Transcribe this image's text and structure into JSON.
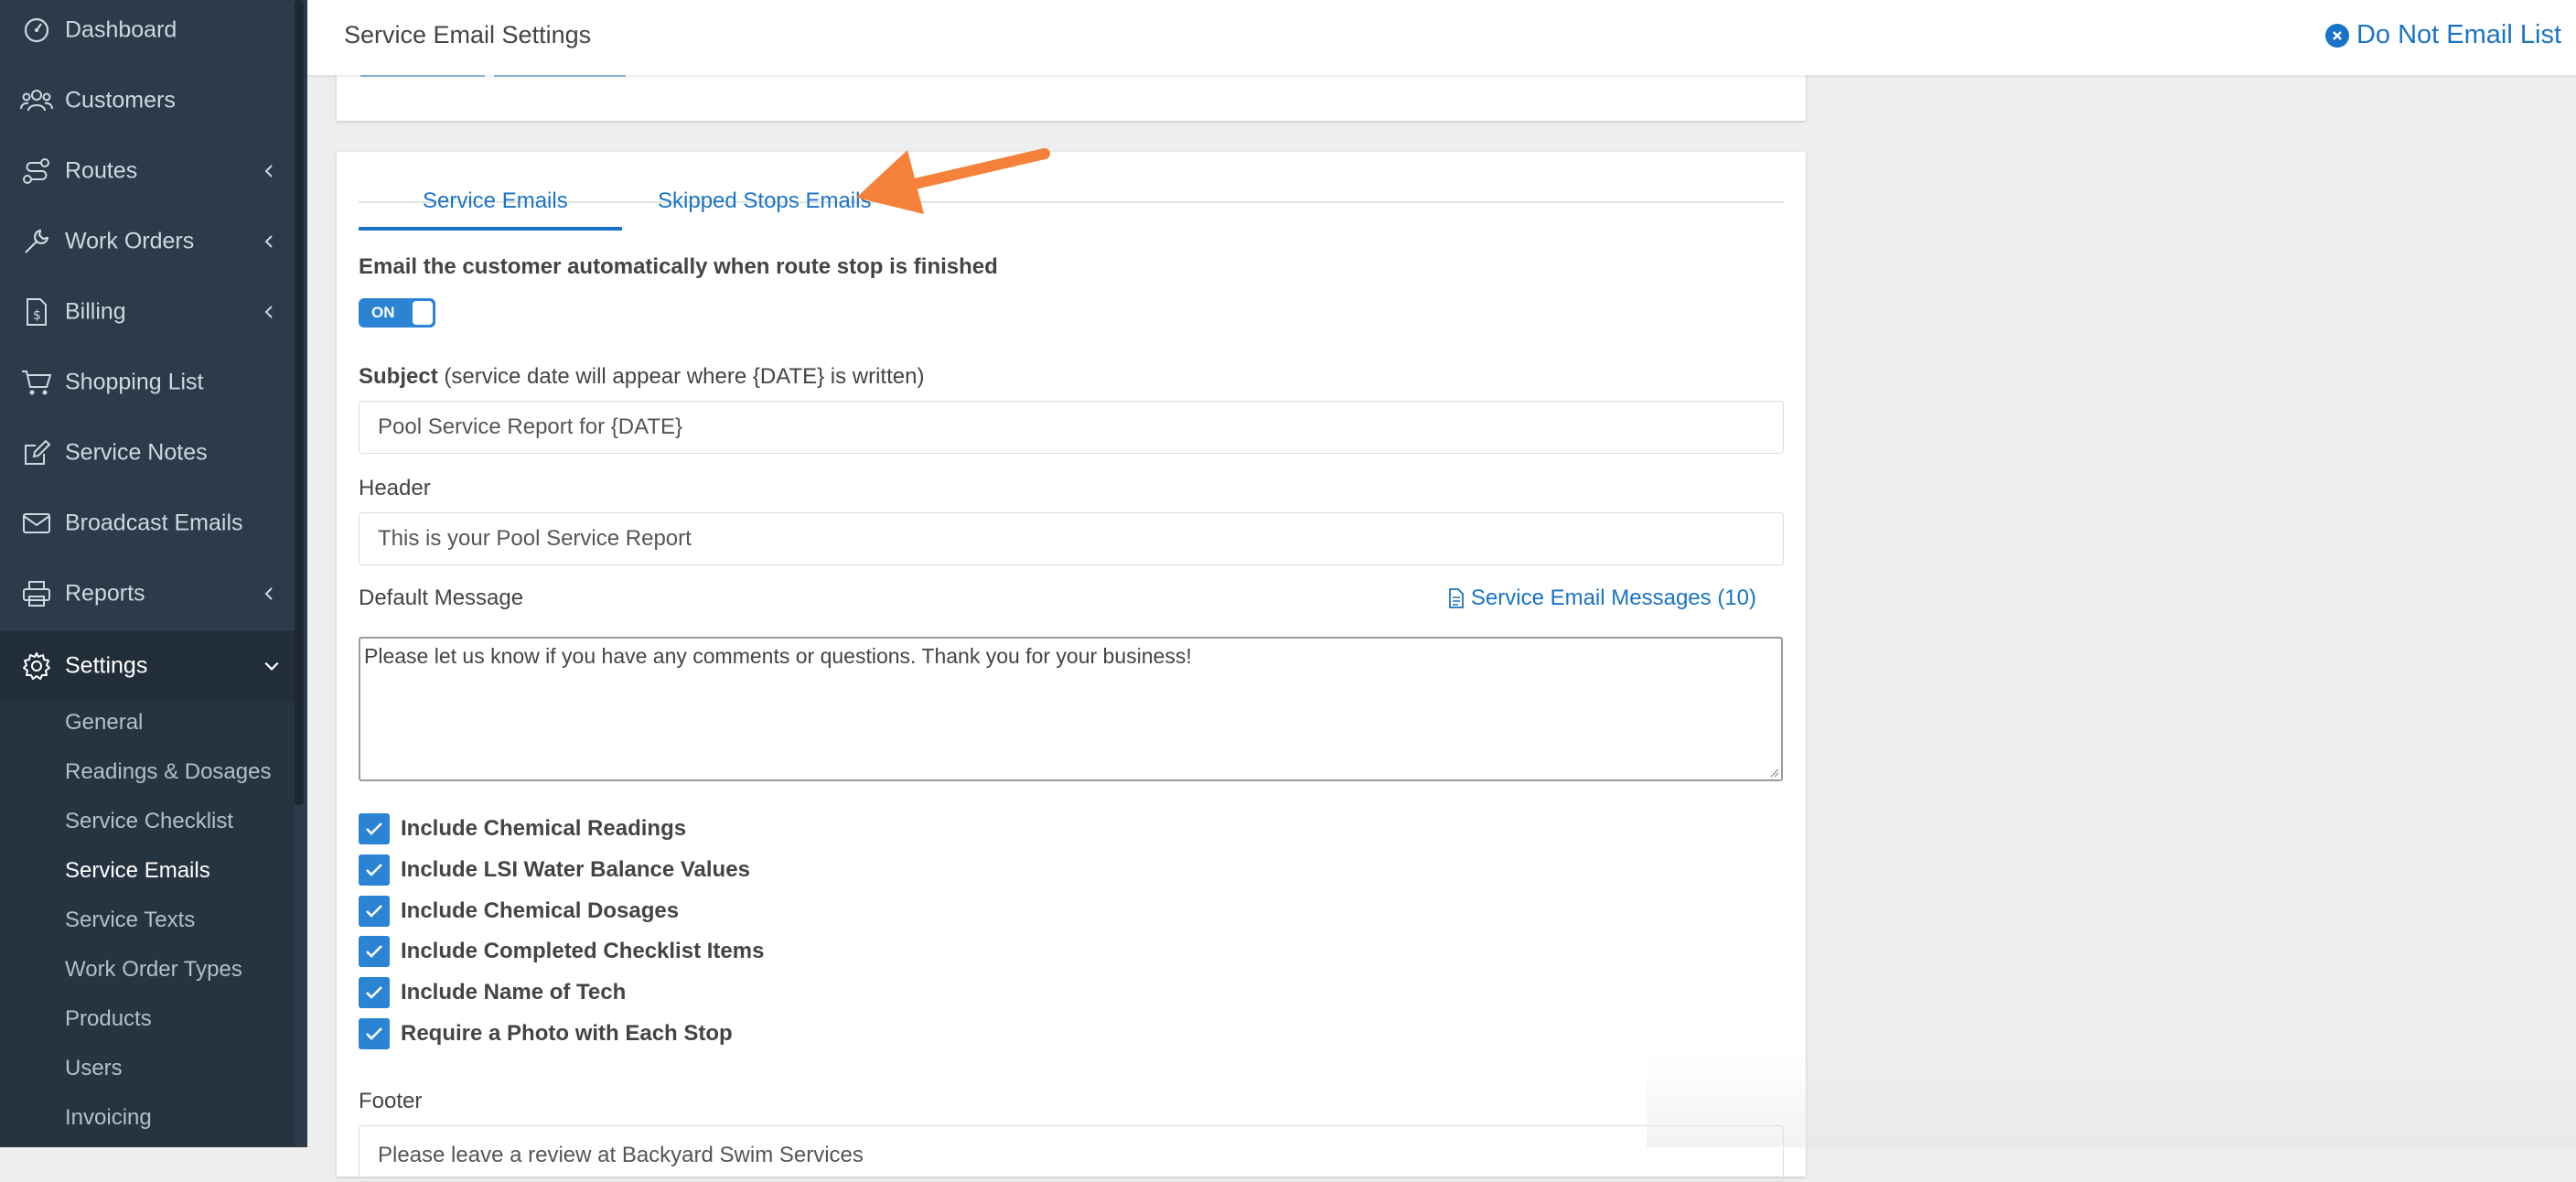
{
  "sidebar": {
    "items": [
      {
        "label": "Dashboard",
        "icon": "dashboard-icon"
      },
      {
        "label": "Customers",
        "icon": "users-icon"
      },
      {
        "label": "Routes",
        "icon": "route-icon"
      },
      {
        "label": "Work Orders",
        "icon": "wrench-icon"
      },
      {
        "label": "Billing",
        "icon": "invoice-dollar-icon"
      },
      {
        "label": "Shopping List",
        "icon": "cart-icon"
      },
      {
        "label": "Service Notes",
        "icon": "edit-icon"
      },
      {
        "label": "Broadcast Emails",
        "icon": "envelope-icon"
      },
      {
        "label": "Reports",
        "icon": "printer-icon"
      },
      {
        "label": "Settings",
        "icon": "gear-icon"
      }
    ],
    "settings_sub": [
      "General",
      "Readings & Dosages",
      "Service Checklist",
      "Service Emails",
      "Service Texts",
      "Work Order Types",
      "Products",
      "Users",
      "Invoicing"
    ],
    "active_sub": "Service Emails"
  },
  "header": {
    "title": "Service Email Settings",
    "do_not_email": "Do Not Email List"
  },
  "tabs": [
    "Service Emails",
    "Skipped Stops Emails"
  ],
  "form": {
    "auto_email_label": "Email the customer automatically when route stop is finished",
    "toggle_label": "ON",
    "subject_label": "Subject",
    "subject_hint": " (service date will appear where {DATE} is written)",
    "subject_value": "Pool Service Report for {DATE}",
    "header_label": "Header",
    "header_value": "This is your Pool Service Report",
    "default_message_label": "Default Message",
    "service_email_messages_link": "Service Email Messages (10)",
    "default_message_value": "Please let us know if you have any comments or questions.  Thank you for your business!",
    "checkboxes": [
      {
        "label": "Include Chemical Readings",
        "checked": true
      },
      {
        "label": "Include LSI Water Balance Values",
        "checked": true
      },
      {
        "label": "Include Chemical Dosages",
        "checked": true
      },
      {
        "label": "Include Completed Checklist Items",
        "checked": true
      },
      {
        "label": "Include Name of Tech",
        "checked": true
      },
      {
        "label": "Require a Photo with Each Stop",
        "checked": true
      }
    ],
    "footer_label": "Footer",
    "footer_value": "Please leave a review at Backyard Swim Services"
  },
  "colors": {
    "sidebar_bg": "#2c3a4a",
    "accent": "#1a73c7",
    "annotation_arrow": "#f5813a"
  }
}
